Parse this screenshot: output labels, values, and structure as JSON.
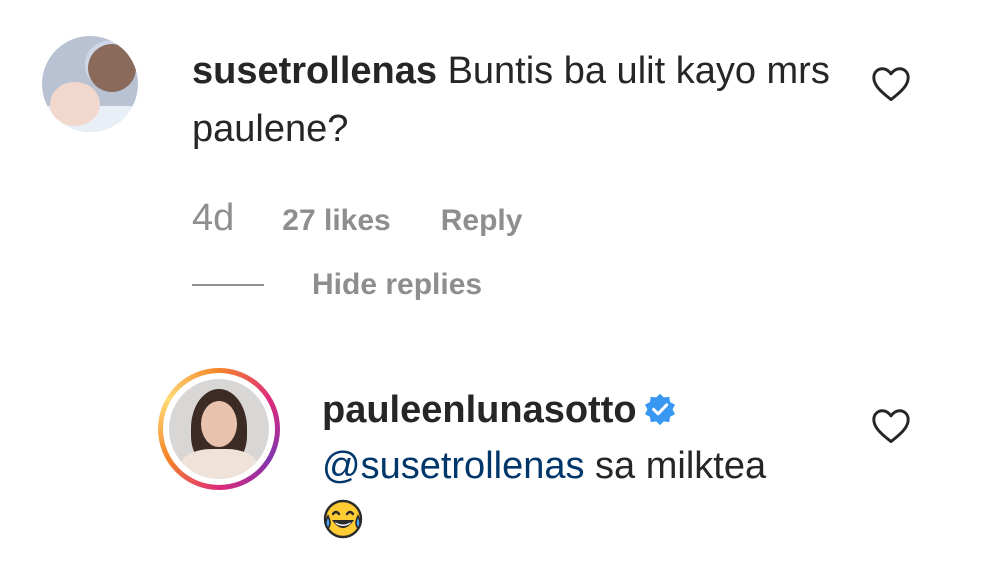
{
  "comments": [
    {
      "username": "susetrollenas",
      "text": "Buntis ba ulit kayo mrs paulene?",
      "time": "4d",
      "likes": "27 likes",
      "reply_label": "Reply",
      "toggle_label": "Hide replies",
      "avatar_icon": "baby-photo-avatar"
    },
    {
      "username": "pauleenlunasotto",
      "verified": true,
      "mention": "@susetrollenas",
      "text": " sa milktea",
      "emoji": "face-with-tears-of-joy",
      "avatar_icon": "woman-photo-avatar",
      "has_story": true
    }
  ],
  "colors": {
    "mention": "#00376b",
    "meta": "#8e8e8e",
    "verified": "#3897f0"
  }
}
